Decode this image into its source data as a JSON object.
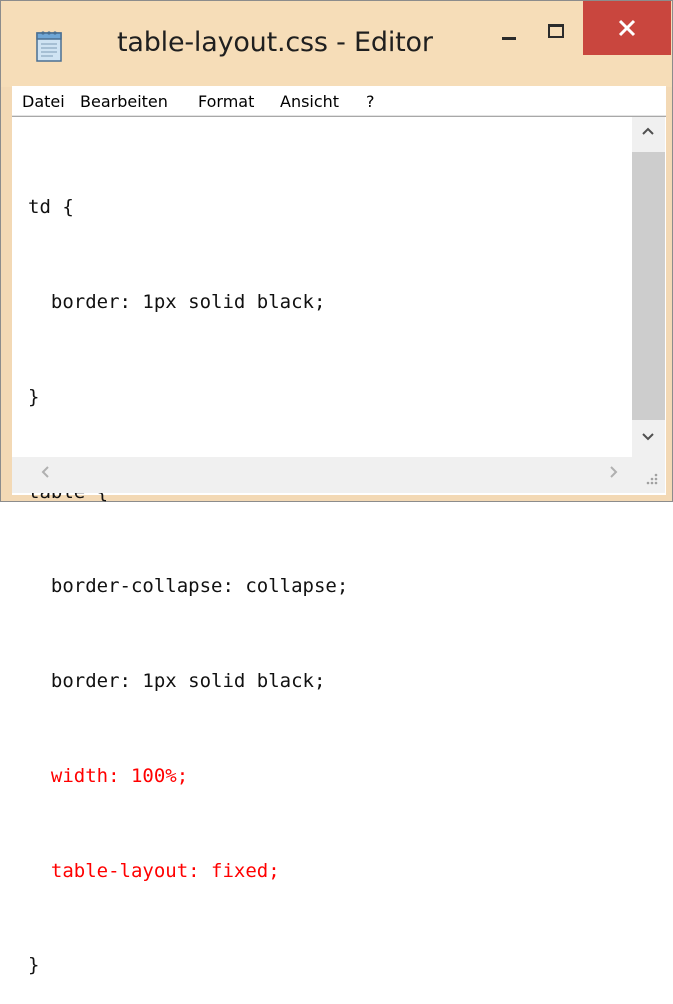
{
  "window": {
    "title": "table-layout.css - Editor",
    "app_icon": "notepad-icon",
    "accent_close": "#c9463e",
    "titlebar_color": "#f6ddb8"
  },
  "menu": {
    "items": [
      "Datei",
      "Bearbeiten",
      "Format",
      "Ansicht",
      "?"
    ]
  },
  "editor": {
    "lines": [
      {
        "text": "td {",
        "highlight": false
      },
      {
        "text": "  border: 1px solid black;",
        "highlight": false
      },
      {
        "text": "}",
        "highlight": false
      },
      {
        "text": "table {",
        "highlight": false
      },
      {
        "text": "  border-collapse: collapse;",
        "highlight": false
      },
      {
        "text": "  border: 1px solid black;",
        "highlight": false
      },
      {
        "text": "  width: 100%;",
        "highlight": true
      },
      {
        "text": "  table-layout: fixed;",
        "highlight": true
      },
      {
        "text": "}",
        "highlight": false
      }
    ],
    "highlight_color": "#ff0000"
  },
  "icons": {
    "minimize": "minimize-icon",
    "maximize": "maximize-icon",
    "close": "close-icon",
    "scroll_up": "chevron-up-icon",
    "scroll_down": "chevron-down-icon",
    "scroll_left": "chevron-left-icon",
    "scroll_right": "chevron-right-icon",
    "resize": "resize-grip-icon"
  }
}
